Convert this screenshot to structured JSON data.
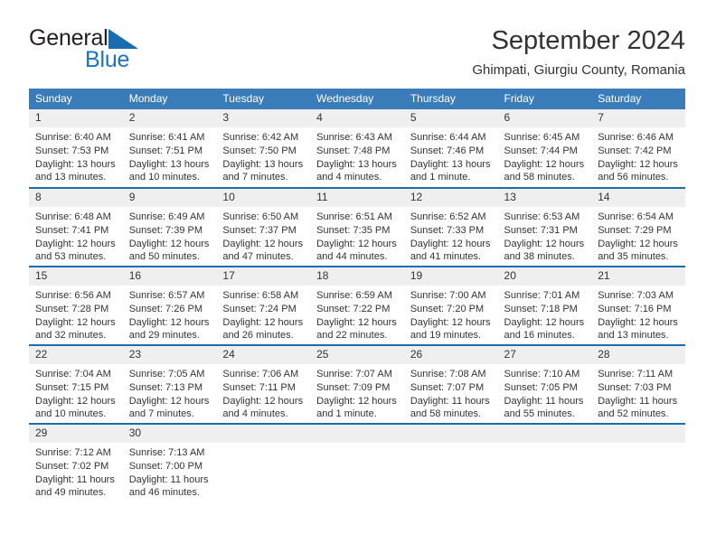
{
  "brand": {
    "name_part1": "General",
    "name_part2": "Blue"
  },
  "header": {
    "title": "September 2024",
    "subtitle": "Ghimpati, Giurgiu County, Romania"
  },
  "weekday_headers": [
    "Sunday",
    "Monday",
    "Tuesday",
    "Wednesday",
    "Thursday",
    "Friday",
    "Saturday"
  ],
  "labels": {
    "sunrise_prefix": "Sunrise:",
    "sunset_prefix": "Sunset:",
    "daylight_prefix": "Daylight:"
  },
  "colors": {
    "header_blue": "#3a7cb9",
    "row_border_blue": "#1b6cb0",
    "daynum_band": "#efefef",
    "brand_blue": "#1b75bb",
    "text": "#333333"
  },
  "weeks": [
    [
      {
        "day": "1",
        "sunrise": "Sunrise: 6:40 AM",
        "sunset": "Sunset: 7:53 PM",
        "daylight_line1": "Daylight: 13 hours",
        "daylight_line2": "and 13 minutes."
      },
      {
        "day": "2",
        "sunrise": "Sunrise: 6:41 AM",
        "sunset": "Sunset: 7:51 PM",
        "daylight_line1": "Daylight: 13 hours",
        "daylight_line2": "and 10 minutes."
      },
      {
        "day": "3",
        "sunrise": "Sunrise: 6:42 AM",
        "sunset": "Sunset: 7:50 PM",
        "daylight_line1": "Daylight: 13 hours",
        "daylight_line2": "and 7 minutes."
      },
      {
        "day": "4",
        "sunrise": "Sunrise: 6:43 AM",
        "sunset": "Sunset: 7:48 PM",
        "daylight_line1": "Daylight: 13 hours",
        "daylight_line2": "and 4 minutes."
      },
      {
        "day": "5",
        "sunrise": "Sunrise: 6:44 AM",
        "sunset": "Sunset: 7:46 PM",
        "daylight_line1": "Daylight: 13 hours",
        "daylight_line2": "and 1 minute."
      },
      {
        "day": "6",
        "sunrise": "Sunrise: 6:45 AM",
        "sunset": "Sunset: 7:44 PM",
        "daylight_line1": "Daylight: 12 hours",
        "daylight_line2": "and 58 minutes."
      },
      {
        "day": "7",
        "sunrise": "Sunrise: 6:46 AM",
        "sunset": "Sunset: 7:42 PM",
        "daylight_line1": "Daylight: 12 hours",
        "daylight_line2": "and 56 minutes."
      }
    ],
    [
      {
        "day": "8",
        "sunrise": "Sunrise: 6:48 AM",
        "sunset": "Sunset: 7:41 PM",
        "daylight_line1": "Daylight: 12 hours",
        "daylight_line2": "and 53 minutes."
      },
      {
        "day": "9",
        "sunrise": "Sunrise: 6:49 AM",
        "sunset": "Sunset: 7:39 PM",
        "daylight_line1": "Daylight: 12 hours",
        "daylight_line2": "and 50 minutes."
      },
      {
        "day": "10",
        "sunrise": "Sunrise: 6:50 AM",
        "sunset": "Sunset: 7:37 PM",
        "daylight_line1": "Daylight: 12 hours",
        "daylight_line2": "and 47 minutes."
      },
      {
        "day": "11",
        "sunrise": "Sunrise: 6:51 AM",
        "sunset": "Sunset: 7:35 PM",
        "daylight_line1": "Daylight: 12 hours",
        "daylight_line2": "and 44 minutes."
      },
      {
        "day": "12",
        "sunrise": "Sunrise: 6:52 AM",
        "sunset": "Sunset: 7:33 PM",
        "daylight_line1": "Daylight: 12 hours",
        "daylight_line2": "and 41 minutes."
      },
      {
        "day": "13",
        "sunrise": "Sunrise: 6:53 AM",
        "sunset": "Sunset: 7:31 PM",
        "daylight_line1": "Daylight: 12 hours",
        "daylight_line2": "and 38 minutes."
      },
      {
        "day": "14",
        "sunrise": "Sunrise: 6:54 AM",
        "sunset": "Sunset: 7:29 PM",
        "daylight_line1": "Daylight: 12 hours",
        "daylight_line2": "and 35 minutes."
      }
    ],
    [
      {
        "day": "15",
        "sunrise": "Sunrise: 6:56 AM",
        "sunset": "Sunset: 7:28 PM",
        "daylight_line1": "Daylight: 12 hours",
        "daylight_line2": "and 32 minutes."
      },
      {
        "day": "16",
        "sunrise": "Sunrise: 6:57 AM",
        "sunset": "Sunset: 7:26 PM",
        "daylight_line1": "Daylight: 12 hours",
        "daylight_line2": "and 29 minutes."
      },
      {
        "day": "17",
        "sunrise": "Sunrise: 6:58 AM",
        "sunset": "Sunset: 7:24 PM",
        "daylight_line1": "Daylight: 12 hours",
        "daylight_line2": "and 26 minutes."
      },
      {
        "day": "18",
        "sunrise": "Sunrise: 6:59 AM",
        "sunset": "Sunset: 7:22 PM",
        "daylight_line1": "Daylight: 12 hours",
        "daylight_line2": "and 22 minutes."
      },
      {
        "day": "19",
        "sunrise": "Sunrise: 7:00 AM",
        "sunset": "Sunset: 7:20 PM",
        "daylight_line1": "Daylight: 12 hours",
        "daylight_line2": "and 19 minutes."
      },
      {
        "day": "20",
        "sunrise": "Sunrise: 7:01 AM",
        "sunset": "Sunset: 7:18 PM",
        "daylight_line1": "Daylight: 12 hours",
        "daylight_line2": "and 16 minutes."
      },
      {
        "day": "21",
        "sunrise": "Sunrise: 7:03 AM",
        "sunset": "Sunset: 7:16 PM",
        "daylight_line1": "Daylight: 12 hours",
        "daylight_line2": "and 13 minutes."
      }
    ],
    [
      {
        "day": "22",
        "sunrise": "Sunrise: 7:04 AM",
        "sunset": "Sunset: 7:15 PM",
        "daylight_line1": "Daylight: 12 hours",
        "daylight_line2": "and 10 minutes."
      },
      {
        "day": "23",
        "sunrise": "Sunrise: 7:05 AM",
        "sunset": "Sunset: 7:13 PM",
        "daylight_line1": "Daylight: 12 hours",
        "daylight_line2": "and 7 minutes."
      },
      {
        "day": "24",
        "sunrise": "Sunrise: 7:06 AM",
        "sunset": "Sunset: 7:11 PM",
        "daylight_line1": "Daylight: 12 hours",
        "daylight_line2": "and 4 minutes."
      },
      {
        "day": "25",
        "sunrise": "Sunrise: 7:07 AM",
        "sunset": "Sunset: 7:09 PM",
        "daylight_line1": "Daylight: 12 hours",
        "daylight_line2": "and 1 minute."
      },
      {
        "day": "26",
        "sunrise": "Sunrise: 7:08 AM",
        "sunset": "Sunset: 7:07 PM",
        "daylight_line1": "Daylight: 11 hours",
        "daylight_line2": "and 58 minutes."
      },
      {
        "day": "27",
        "sunrise": "Sunrise: 7:10 AM",
        "sunset": "Sunset: 7:05 PM",
        "daylight_line1": "Daylight: 11 hours",
        "daylight_line2": "and 55 minutes."
      },
      {
        "day": "28",
        "sunrise": "Sunrise: 7:11 AM",
        "sunset": "Sunset: 7:03 PM",
        "daylight_line1": "Daylight: 11 hours",
        "daylight_line2": "and 52 minutes."
      }
    ],
    [
      {
        "day": "29",
        "sunrise": "Sunrise: 7:12 AM",
        "sunset": "Sunset: 7:02 PM",
        "daylight_line1": "Daylight: 11 hours",
        "daylight_line2": "and 49 minutes."
      },
      {
        "day": "30",
        "sunrise": "Sunrise: 7:13 AM",
        "sunset": "Sunset: 7:00 PM",
        "daylight_line1": "Daylight: 11 hours",
        "daylight_line2": "and 46 minutes."
      },
      {
        "day": "",
        "sunrise": "",
        "sunset": "",
        "daylight_line1": "",
        "daylight_line2": ""
      },
      {
        "day": "",
        "sunrise": "",
        "sunset": "",
        "daylight_line1": "",
        "daylight_line2": ""
      },
      {
        "day": "",
        "sunrise": "",
        "sunset": "",
        "daylight_line1": "",
        "daylight_line2": ""
      },
      {
        "day": "",
        "sunrise": "",
        "sunset": "",
        "daylight_line1": "",
        "daylight_line2": ""
      },
      {
        "day": "",
        "sunrise": "",
        "sunset": "",
        "daylight_line1": "",
        "daylight_line2": ""
      }
    ]
  ]
}
